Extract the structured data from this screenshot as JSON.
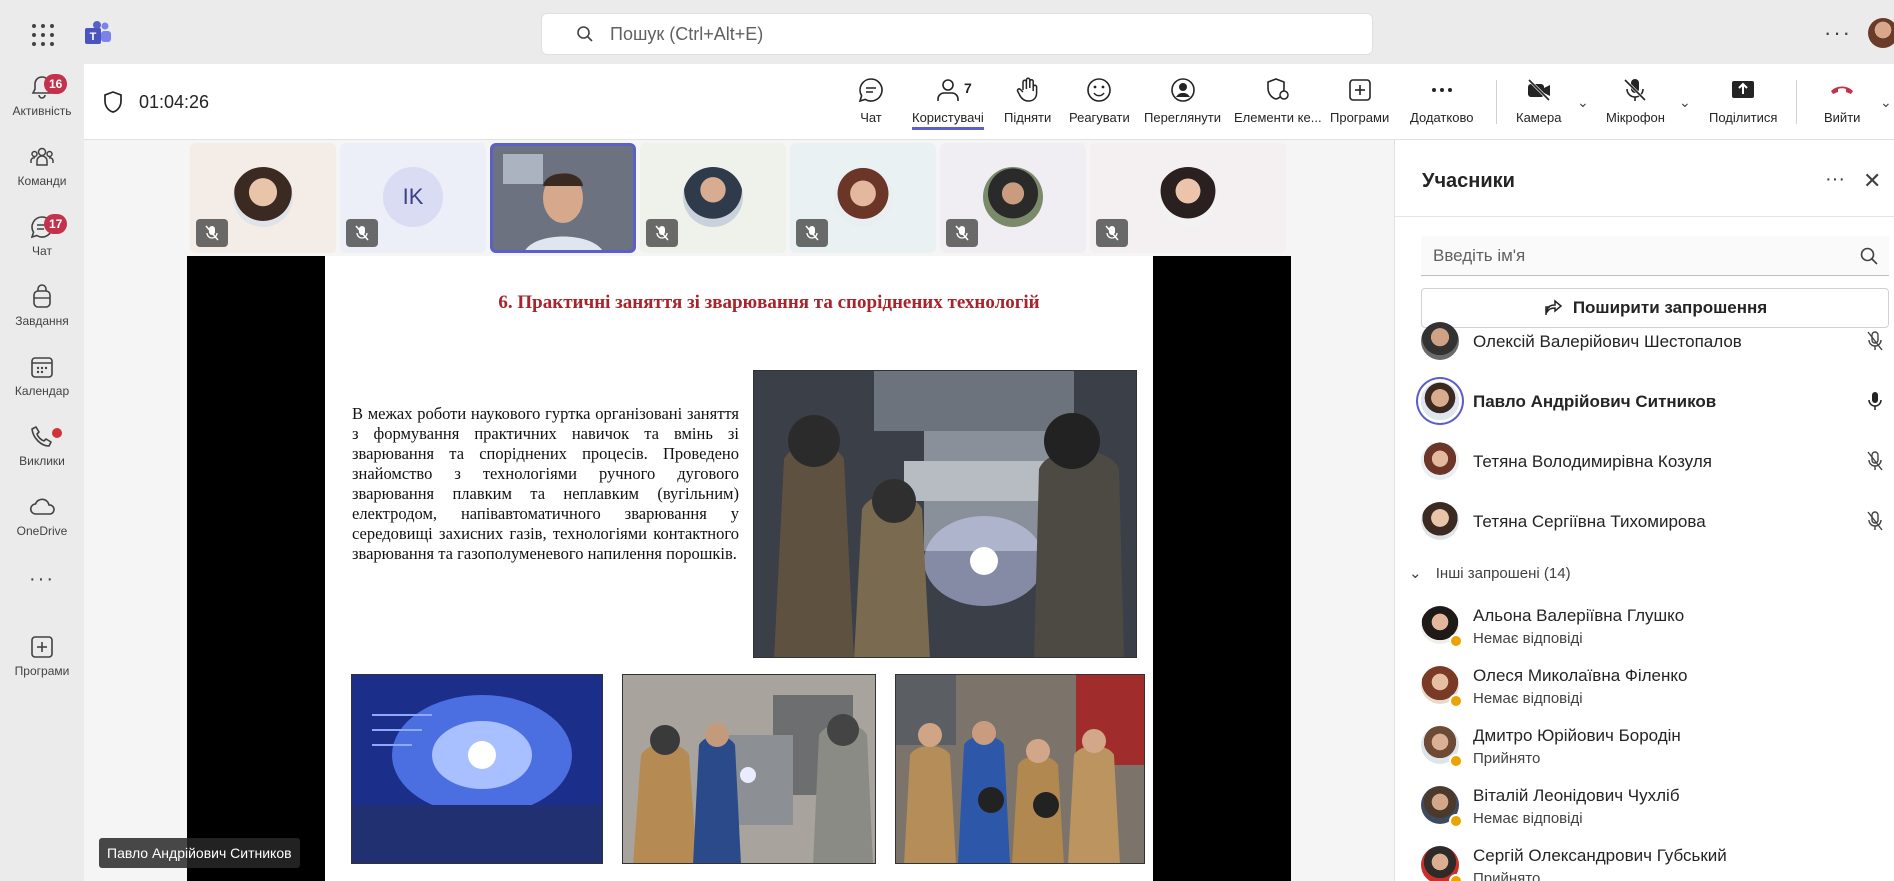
{
  "app": {
    "search_placeholder": "Пошук (Ctrl+Alt+E)",
    "more": "···"
  },
  "rail": [
    {
      "label": "Активність",
      "icon": "bell-icon",
      "badge": "16"
    },
    {
      "label": "Команди",
      "icon": "teams-icon"
    },
    {
      "label": "Чат",
      "icon": "chat-icon",
      "badge": "17"
    },
    {
      "label": "Завдання",
      "icon": "backpack-icon"
    },
    {
      "label": "Календар",
      "icon": "calendar-icon"
    },
    {
      "label": "Виклики",
      "icon": "phone-icon",
      "dot": true
    },
    {
      "label": "OneDrive",
      "icon": "cloud-icon"
    },
    {
      "label": "···",
      "icon": "more-icon"
    },
    {
      "label": "Програми",
      "icon": "plus-icon"
    }
  ],
  "meeting": {
    "timer": "01:04:26",
    "tools": {
      "chat": "Чат",
      "people": "Користувачі",
      "people_count": "7",
      "raise": "Підняти",
      "react": "Реагувати",
      "view": "Переглянути",
      "elements": "Елементи ке...",
      "apps": "Програми",
      "more": "Додатково",
      "camera": "Камера",
      "mic": "Мікрофон",
      "share": "Поділитися",
      "leave": "Вийти"
    },
    "tile_initials": "IK",
    "speaker_label": "Павло Андрійович Ситников"
  },
  "slide": {
    "title": "6. Практичні заняття зі зварювання та споріднених технологій",
    "text": "В межах роботи наукового гуртка організовані заняття з формування практичних навичок та вмінь зі зварювання та споріднених процесів. Проведено знайомство з технологіями ручного дугового зварювання плавким та неплавким (вугільним) електродом, напівавтоматичного зварювання у середовищі захисних газів, технологіями контактного зварювання та газополуменевого напилення порошків."
  },
  "panel": {
    "title": "Учасники",
    "search_placeholder": "Введіть ім'я",
    "invite": "Поширити запрошення",
    "in_meeting": [
      {
        "name": "Олексій Валерійович Шестопалов",
        "mic": "muted"
      },
      {
        "name": "Павло Андрійович Ситников",
        "mic": "on"
      },
      {
        "name": "Тетяна Володимирівна Козуля",
        "mic": "muted"
      },
      {
        "name": "Тетяна Сергіївна Тихомирова",
        "mic": "muted"
      }
    ],
    "others_header": "Інші запрошені (14)",
    "others": [
      {
        "name": "Альона Валеріївна Глушко",
        "status": "Немає відповіді"
      },
      {
        "name": "Олеся Миколаївна Філенко",
        "status": "Немає відповіді"
      },
      {
        "name": "Дмитро Юрійович Бородін",
        "status": "Прийнято"
      },
      {
        "name": "Віталій Леонідович Чухліб",
        "status": "Немає відповіді"
      },
      {
        "name": "Сергій Олександрович Губський",
        "status": "Прийнято"
      }
    ]
  },
  "colors": {
    "accent": "#5b5fc7",
    "badge": "#c4314b",
    "leave": "#c4314b",
    "title_red": "#a8232a"
  }
}
